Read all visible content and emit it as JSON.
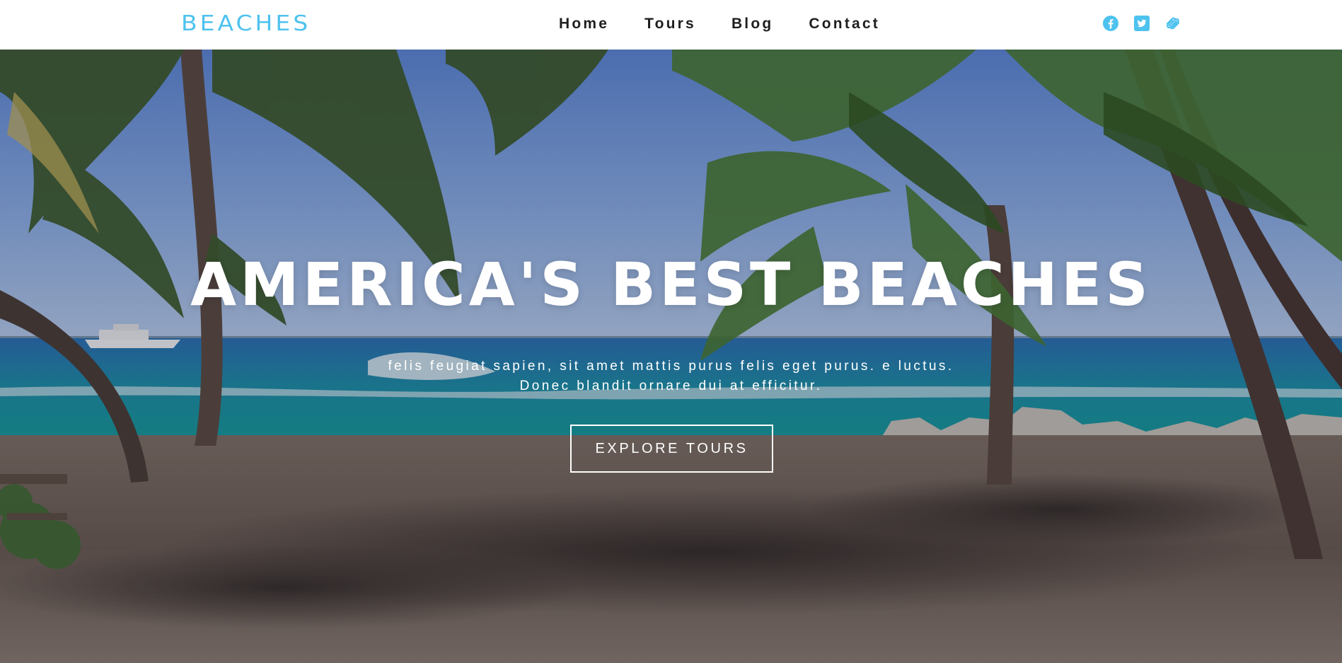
{
  "header": {
    "logo": "BEACHES",
    "nav": [
      "Home",
      "Tours",
      "Blog",
      "Contact"
    ],
    "social": [
      "facebook-icon",
      "twitter-icon",
      "squarespace-icon"
    ]
  },
  "hero": {
    "title": "AMERICA'S BEST BEACHES",
    "subtitle_line1": "felis feugiat sapien, sit amet mattis purus felis eget purus. e luctus.",
    "subtitle_line2": "Donec blandit ornare dui at efficitur.",
    "cta": "EXPLORE TOURS"
  },
  "colors": {
    "brand": "#4ec2ee",
    "nav_text": "#1e1e1e",
    "sky": "#6a93d6",
    "sea": "#1f8ea6",
    "sand": "#6e5e52"
  }
}
